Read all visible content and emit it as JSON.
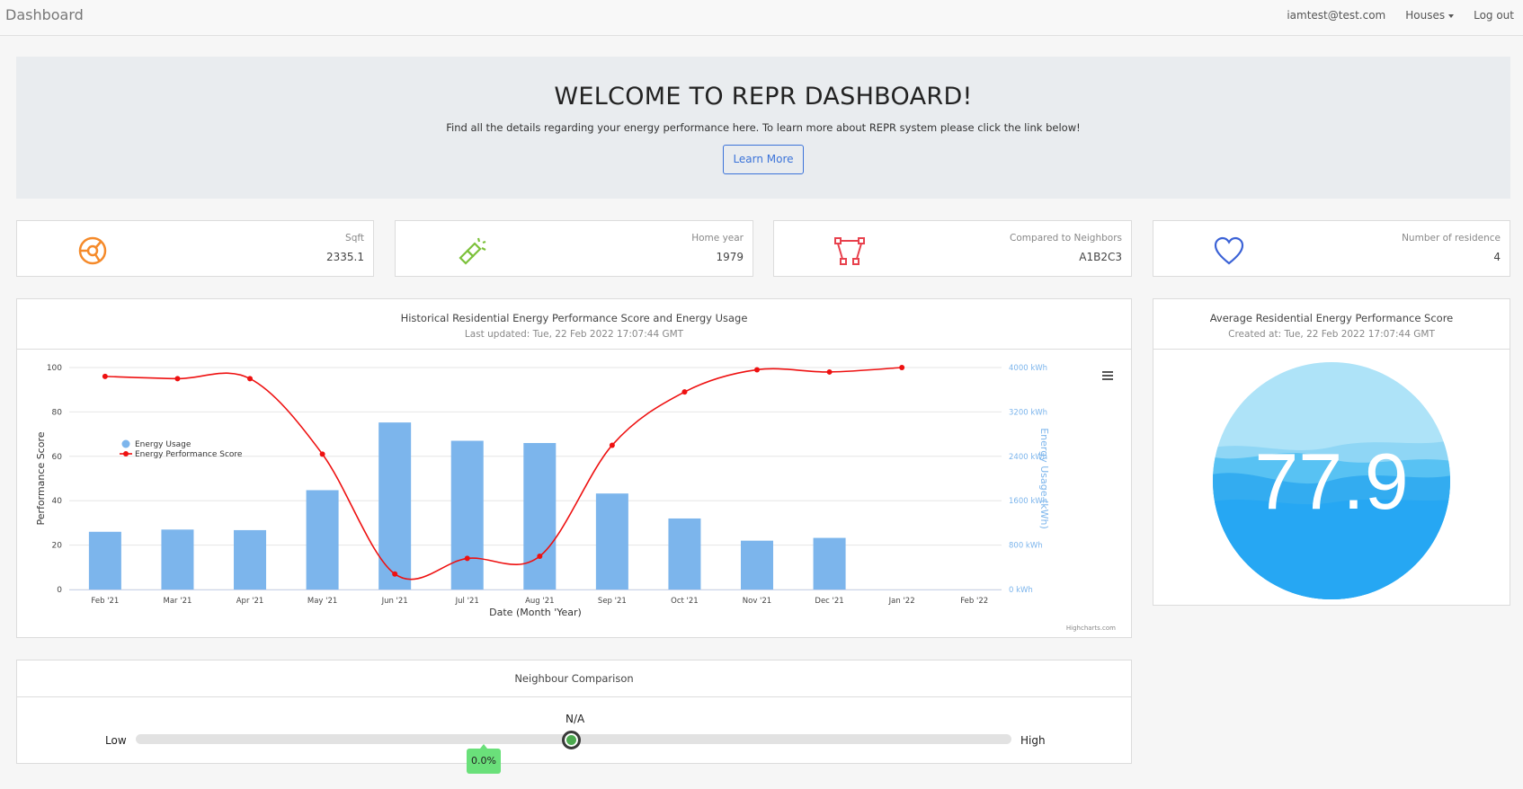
{
  "nav": {
    "brand": "Dashboard",
    "user": "iamtest@test.com",
    "houses": "Houses",
    "logout": "Log out"
  },
  "jumbotron": {
    "title": "WELCOME TO REPR DASHBOARD!",
    "text": "Find all the details regarding your energy performance here. To learn more about REPR system please click the link below!",
    "button": "Learn More"
  },
  "stats": [
    {
      "label": "Sqft",
      "value": "2335.1",
      "icon": "dashboard-dial-icon",
      "color": "#f58a2a"
    },
    {
      "label": "Home year",
      "value": "1979",
      "icon": "flashlight-icon",
      "color": "#7cc13a"
    },
    {
      "label": "Compared to Neighbors",
      "value": "A1B2C3",
      "icon": "vector-shape-icon",
      "color": "#e8414d"
    },
    {
      "label": "Number of residence",
      "value": "4",
      "icon": "heart-icon",
      "color": "#3b62d6"
    }
  ],
  "historical": {
    "title": "Historical Residential Energy Performance Score and Energy Usage",
    "subtitle": "Last updated: Tue, 22 Feb 2022 17:07:44 GMT",
    "credit": "Highcharts.com"
  },
  "average": {
    "title": "Average Residential Energy Performance Score",
    "subtitle": "Created at: Tue, 22 Feb 2022 17:07:44 GMT",
    "value": "77.9"
  },
  "neighbour": {
    "title": "Neighbour Comparison",
    "low": "Low",
    "high": "High",
    "na": "N/A",
    "tooltip": "0.0%"
  },
  "chart_data": {
    "type": "bar",
    "xlabel": "Date (Month 'Year)",
    "ylabel": "Performance Score",
    "y2label": "Energy Usage (kWh)",
    "categories": [
      "Feb '21",
      "Mar '21",
      "Apr '21",
      "May '21",
      "Jun '21",
      "Jul '21",
      "Aug '21",
      "Sep '21",
      "Oct '21",
      "Nov '21",
      "Dec '21",
      "Jan '22",
      "Feb '22"
    ],
    "y_ticks": [
      "0",
      "20",
      "40",
      "60",
      "80",
      "100"
    ],
    "y2_ticks": [
      "0 kWh",
      "800 kWh",
      "1600 kWh",
      "2400 kWh",
      "3200 kWh",
      "4000 kWh"
    ],
    "ylim": [
      0,
      100
    ],
    "y2lim": [
      0,
      4000
    ],
    "legend_position": "left",
    "series": [
      {
        "name": "Energy Usage",
        "type": "bar",
        "axis": "right",
        "color": "#7cb5ec",
        "values": [
          1040,
          1080,
          1070,
          1790,
          3010,
          2680,
          2640,
          1730,
          1280,
          880,
          930,
          null,
          null
        ]
      },
      {
        "name": "Energy Performance Score",
        "type": "line",
        "axis": "left",
        "color": "#ee1111",
        "values": [
          96,
          95,
          95,
          61,
          7,
          14,
          15,
          65,
          89,
          99,
          98,
          100,
          null
        ]
      }
    ]
  }
}
